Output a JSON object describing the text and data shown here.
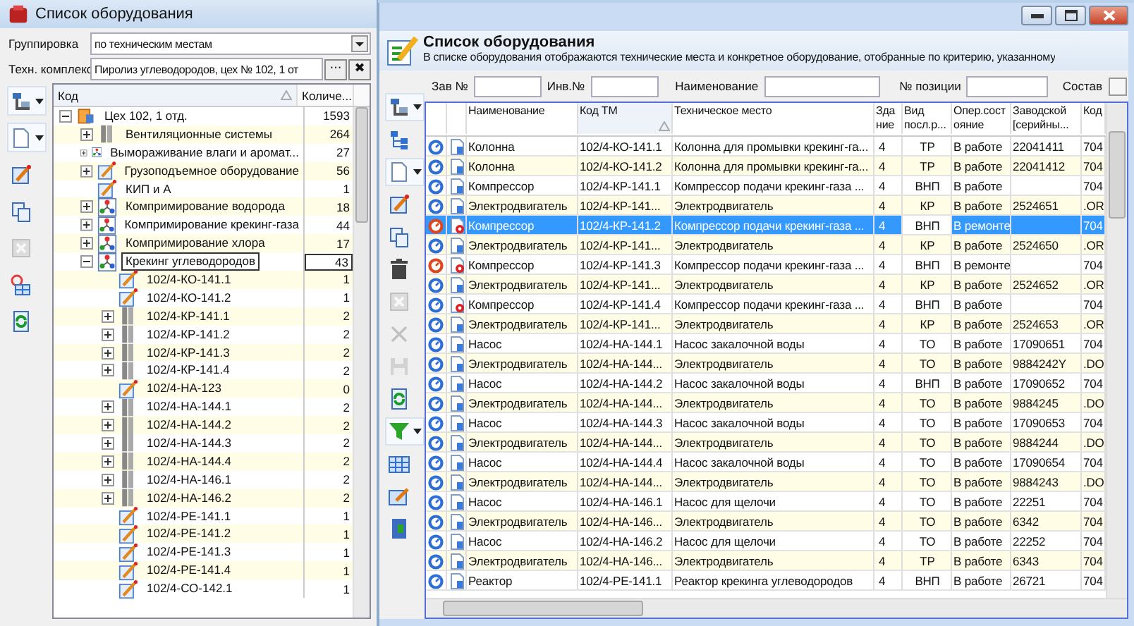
{
  "window": {
    "title": "Список оборудования"
  },
  "grouping": {
    "label": "Группировка",
    "value": "по техническим местам"
  },
  "complex": {
    "label": "Техн. комплекс",
    "value": "Пиролиз углеводородов, цех № 102, 1 от",
    "browse": "···",
    "clear": "✖"
  },
  "left_toolbar": [
    {
      "kind": "layout",
      "dropdown": true,
      "disabled": false
    },
    {
      "kind": "new",
      "dropdown": true,
      "disabled": false
    },
    {
      "kind": "edit",
      "dropdown": false,
      "disabled": false
    },
    {
      "kind": "copy",
      "dropdown": false,
      "disabled": false
    },
    {
      "kind": "delete",
      "dropdown": false,
      "disabled": true
    },
    {
      "kind": "group",
      "dropdown": false,
      "disabled": false
    },
    {
      "kind": "refresh",
      "dropdown": false,
      "disabled": false
    }
  ],
  "tree": {
    "columns": [
      {
        "label": "Код",
        "sorted": true
      },
      {
        "label": "Количе...",
        "sorted": false
      }
    ],
    "nodes": [
      {
        "kind": "unit",
        "label": "Цех 102, 1 отд.",
        "count": "1593",
        "expanded": true,
        "selected": false,
        "children": [
          {
            "kind": "system",
            "label": "Вентиляционные системы",
            "count": "264",
            "expanded": false,
            "selected": false
          },
          {
            "kind": "group",
            "label": "Вымораживание влаги и аромат...",
            "count": "27",
            "expanded": false,
            "selected": false
          },
          {
            "kind": "position",
            "label": "Грузоподъемное оборудование",
            "count": "56",
            "expanded": false,
            "selected": false
          },
          {
            "kind": "position",
            "label": "КИП и А",
            "count": "1",
            "selected": false
          },
          {
            "kind": "group",
            "label": "Компримирование водорода",
            "count": "18",
            "expanded": false,
            "selected": false
          },
          {
            "kind": "group",
            "label": "Компримирование крекинг-газа",
            "count": "44",
            "expanded": false,
            "selected": false
          },
          {
            "kind": "group",
            "label": "Компримирование хлора",
            "count": "17",
            "expanded": false,
            "selected": false
          },
          {
            "kind": "group",
            "label": "Крекинг углеводородов",
            "count": "43",
            "expanded": true,
            "selected": true,
            "children": [
              {
                "kind": "position",
                "label": "102/4-КО-141.1",
                "count": "1",
                "selected": false
              },
              {
                "kind": "position",
                "label": "102/4-КО-141.2",
                "count": "1",
                "selected": false
              },
              {
                "kind": "system",
                "label": "102/4-КР-141.1",
                "count": "2",
                "expanded": false,
                "selected": false
              },
              {
                "kind": "system",
                "label": "102/4-КР-141.2",
                "count": "2",
                "expanded": false,
                "selected": false
              },
              {
                "kind": "system",
                "label": "102/4-КР-141.3",
                "count": "2",
                "expanded": false,
                "selected": false
              },
              {
                "kind": "system",
                "label": "102/4-КР-141.4",
                "count": "2",
                "expanded": false,
                "selected": false
              },
              {
                "kind": "position",
                "label": "102/4-НА-123",
                "count": "0",
                "selected": false
              },
              {
                "kind": "system",
                "label": "102/4-НА-144.1",
                "count": "2",
                "expanded": false,
                "selected": false
              },
              {
                "kind": "system",
                "label": "102/4-НА-144.2",
                "count": "2",
                "expanded": false,
                "selected": false
              },
              {
                "kind": "system",
                "label": "102/4-НА-144.3",
                "count": "2",
                "expanded": false,
                "selected": false
              },
              {
                "kind": "system",
                "label": "102/4-НА-144.4",
                "count": "2",
                "expanded": false,
                "selected": false
              },
              {
                "kind": "system",
                "label": "102/4-НА-146.1",
                "count": "2",
                "expanded": false,
                "selected": false
              },
              {
                "kind": "system",
                "label": "102/4-НА-146.2",
                "count": "2",
                "expanded": false,
                "selected": false
              },
              {
                "kind": "position",
                "label": "102/4-РЕ-141.1",
                "count": "1",
                "selected": false
              },
              {
                "kind": "position",
                "label": "102/4-РЕ-141.2",
                "count": "1",
                "selected": false
              },
              {
                "kind": "position",
                "label": "102/4-РЕ-141.3",
                "count": "1",
                "selected": false
              },
              {
                "kind": "position",
                "label": "102/4-РЕ-141.4",
                "count": "1",
                "selected": false
              },
              {
                "kind": "position",
                "label": "102/4-СО-142.1",
                "count": "1",
                "selected": false
              }
            ]
          }
        ]
      }
    ]
  },
  "header": {
    "title": "Список оборудования",
    "subtitle": "В списке оборудования отображаются технические места и конкретное оборудование, отобранные по критерию, указанному"
  },
  "filters": [
    {
      "label": "Зав №"
    },
    {
      "label": "Инв.№"
    },
    {
      "label": "Наименование"
    },
    {
      "label": "№ позиции"
    }
  ],
  "composition": {
    "label": "Состав",
    "checked": false
  },
  "right_toolbar": [
    {
      "kind": "layout",
      "dropdown": true,
      "disabled": false
    },
    {
      "kind": "hierarchy",
      "dropdown": false,
      "disabled": false
    },
    {
      "kind": "new",
      "dropdown": true,
      "disabled": false
    },
    {
      "kind": "edit",
      "dropdown": false,
      "disabled": false
    },
    {
      "kind": "copy",
      "dropdown": false,
      "disabled": false
    },
    {
      "kind": "trash",
      "dropdown": false,
      "disabled": false
    },
    {
      "kind": "delete",
      "dropdown": false,
      "disabled": true
    },
    {
      "kind": "close",
      "dropdown": false,
      "disabled": true
    },
    {
      "kind": "save",
      "dropdown": false,
      "disabled": true
    },
    {
      "kind": "refresh",
      "dropdown": false,
      "disabled": false
    },
    {
      "kind": "filter",
      "dropdown": true,
      "disabled": false
    },
    {
      "kind": "grid",
      "dropdown": false,
      "disabled": false
    },
    {
      "kind": "editform",
      "dropdown": false,
      "disabled": false
    },
    {
      "kind": "exit",
      "dropdown": false,
      "disabled": false
    }
  ],
  "table": {
    "columns": [
      {
        "label": "Наименование",
        "sorted": false
      },
      {
        "label": "Код ТМ",
        "sorted": true
      },
      {
        "label": "Техническое место",
        "sorted": false
      },
      {
        "label": "Здание",
        "sorted": false
      },
      {
        "label": "Вид посл.р...",
        "sorted": false
      },
      {
        "label": "Опер.состояние",
        "sorted": false
      },
      {
        "label": "Заводской [серийны...",
        "sorted": false
      },
      {
        "label": "Код",
        "sorted": false
      }
    ],
    "rows": [
      {
        "in_repair": false,
        "flagged": false,
        "selected": false,
        "cells": [
          "Колонна",
          "102/4-КО-141.1",
          "Колонна для промывки крекинг-га...",
          "4",
          "ТР",
          "В работе",
          "22041411",
          "704"
        ]
      },
      {
        "in_repair": false,
        "flagged": false,
        "selected": false,
        "cells": [
          "Колонна",
          "102/4-КО-141.2",
          "Колонна для промывки крекинг-га...",
          "4",
          "ТР",
          "В работе",
          "22041412",
          "704"
        ]
      },
      {
        "in_repair": false,
        "flagged": false,
        "selected": false,
        "cells": [
          "Компрессор",
          "102/4-КР-141.1",
          "Компрессор подачи крекинг-газа ...",
          "4",
          "ВНП",
          "В работе",
          "",
          "704"
        ]
      },
      {
        "in_repair": false,
        "flagged": false,
        "selected": false,
        "cells": [
          "Электродвигатель",
          "102/4-КР-141...",
          "Электродвигатель",
          "4",
          "КР",
          "В работе",
          "2524651",
          ".OR"
        ]
      },
      {
        "in_repair": true,
        "flagged": true,
        "selected": true,
        "cells": [
          "Компрессор",
          "102/4-КР-141.2",
          "Компрессор подачи крекинг-газа ...",
          "4",
          "ВНП",
          "В ремонте",
          "",
          "704"
        ]
      },
      {
        "in_repair": false,
        "flagged": false,
        "selected": false,
        "cells": [
          "Электродвигатель",
          "102/4-КР-141...",
          "Электродвигатель",
          "4",
          "КР",
          "В работе",
          "2524650",
          ".OR"
        ]
      },
      {
        "in_repair": true,
        "flagged": true,
        "selected": false,
        "cells": [
          "Компрессор",
          "102/4-КР-141.3",
          "Компрессор подачи крекинг-газа ...",
          "4",
          "ВНП",
          "В ремонте",
          "",
          "704"
        ]
      },
      {
        "in_repair": false,
        "flagged": false,
        "selected": false,
        "cells": [
          "Электродвигатель",
          "102/4-КР-141...",
          "Электродвигатель",
          "4",
          "КР",
          "В работе",
          "2524652",
          ".OR"
        ]
      },
      {
        "in_repair": false,
        "flagged": true,
        "selected": false,
        "cells": [
          "Компрессор",
          "102/4-КР-141.4",
          "Компрессор подачи крекинг-газа ...",
          "4",
          "ВНП",
          "В работе",
          "",
          "704"
        ]
      },
      {
        "in_repair": false,
        "flagged": false,
        "selected": false,
        "cells": [
          "Электродвигатель",
          "102/4-КР-141...",
          "Электродвигатель",
          "4",
          "КР",
          "В работе",
          "2524653",
          ".OR"
        ]
      },
      {
        "in_repair": false,
        "flagged": false,
        "selected": false,
        "cells": [
          "Насос",
          "102/4-НА-144.1",
          "Насос закалочной воды",
          "4",
          "ТО",
          "В работе",
          "17090651",
          "704"
        ]
      },
      {
        "in_repair": false,
        "flagged": false,
        "selected": false,
        "cells": [
          "Электродвигатель",
          "102/4-НА-144...",
          "Электродвигатель",
          "4",
          "ТО",
          "В работе",
          "9884242Y",
          ".DO"
        ]
      },
      {
        "in_repair": false,
        "flagged": false,
        "selected": false,
        "cells": [
          "Насос",
          "102/4-НА-144.2",
          "Насос закалочной воды",
          "4",
          "ВНП",
          "В работе",
          "17090652",
          "704"
        ]
      },
      {
        "in_repair": false,
        "flagged": false,
        "selected": false,
        "cells": [
          "Электродвигатель",
          "102/4-НА-144...",
          "Электродвигатель",
          "4",
          "ТО",
          "В работе",
          "9884245",
          ".DO"
        ]
      },
      {
        "in_repair": false,
        "flagged": false,
        "selected": false,
        "cells": [
          "Насос",
          "102/4-НА-144.3",
          "Насос закалочной воды",
          "4",
          "ТО",
          "В работе",
          "17090653",
          "704"
        ]
      },
      {
        "in_repair": false,
        "flagged": false,
        "selected": false,
        "cells": [
          "Электродвигатель",
          "102/4-НА-144...",
          "Электродвигатель",
          "4",
          "ТО",
          "В работе",
          "9884244",
          ".DO"
        ]
      },
      {
        "in_repair": false,
        "flagged": false,
        "selected": false,
        "cells": [
          "Насос",
          "102/4-НА-144.4",
          "Насос закалочной воды",
          "4",
          "ТО",
          "В работе",
          "17090654",
          "704"
        ]
      },
      {
        "in_repair": false,
        "flagged": false,
        "selected": false,
        "cells": [
          "Электродвигатель",
          "102/4-НА-144...",
          "Электродвигатель",
          "4",
          "ТО",
          "В работе",
          "9884243",
          ".DO"
        ]
      },
      {
        "in_repair": false,
        "flagged": false,
        "selected": false,
        "cells": [
          "Насос",
          "102/4-НА-146.1",
          "Насос для щелочи",
          "4",
          "ТО",
          "В работе",
          "22251",
          "704"
        ]
      },
      {
        "in_repair": false,
        "flagged": false,
        "selected": false,
        "cells": [
          "Электродвигатель",
          "102/4-НА-146...",
          "Электродвигатель",
          "4",
          "ТО",
          "В работе",
          "6342",
          "704"
        ]
      },
      {
        "in_repair": false,
        "flagged": false,
        "selected": false,
        "cells": [
          "Насос",
          "102/4-НА-146.2",
          "Насос для щелочи",
          "4",
          "ТО",
          "В работе",
          "22252",
          "704"
        ]
      },
      {
        "in_repair": false,
        "flagged": false,
        "selected": false,
        "cells": [
          "Электродвигатель",
          "102/4-НА-146...",
          "Электродвигатель",
          "4",
          "ТР",
          "В работе",
          "6343",
          "704"
        ]
      },
      {
        "in_repair": false,
        "flagged": false,
        "selected": false,
        "cells": [
          "Реактор",
          "102/4-РЕ-141.1",
          "Реактор крекинга углеводородов",
          "4",
          "ВНП",
          "В работе",
          "26721",
          "704"
        ]
      }
    ]
  }
}
